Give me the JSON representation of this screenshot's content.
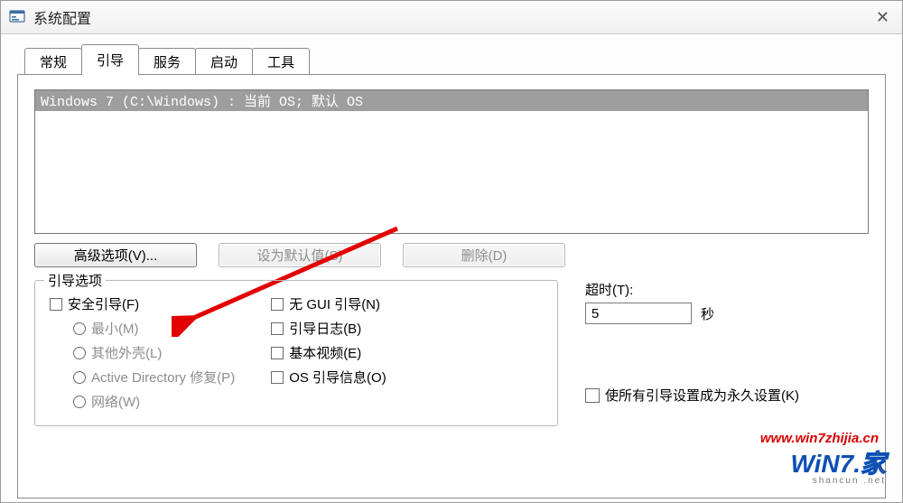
{
  "window": {
    "title": "系统配置",
    "close_glyph": "✕"
  },
  "tabs": {
    "general": "常规",
    "boot": "引导",
    "services": "服务",
    "startup": "启动",
    "tools": "工具",
    "active": "boot"
  },
  "bootlist": {
    "entry": "Windows 7 (C:\\Windows) : 当前 OS; 默认 OS"
  },
  "buttons": {
    "advanced": "高级选项(V)...",
    "set_default": "设为默认值(S)",
    "delete": "删除(D)"
  },
  "boot_options": {
    "legend": "引导选项",
    "safe_boot": "安全引导(F)",
    "min": "最小(M)",
    "altshell": "其他外壳(L)",
    "adrepair": "Active Directory 修复(P)",
    "network": "网络(W)",
    "no_gui": "无 GUI 引导(N)",
    "bootlog": "引导日志(B)",
    "basevideo": "基本视频(E)",
    "osbootinfo": "OS 引导信息(O)"
  },
  "timeout": {
    "label": "超时(T):",
    "value": "5",
    "unit": "秒"
  },
  "permanent": {
    "label": "使所有引导设置成为永久设置(K)"
  },
  "watermarks": {
    "url": "www.win7zhijia.cn",
    "logo_main": "WiN7.",
    "logo_accent": "家",
    "logo_sub": "shancun .net"
  }
}
